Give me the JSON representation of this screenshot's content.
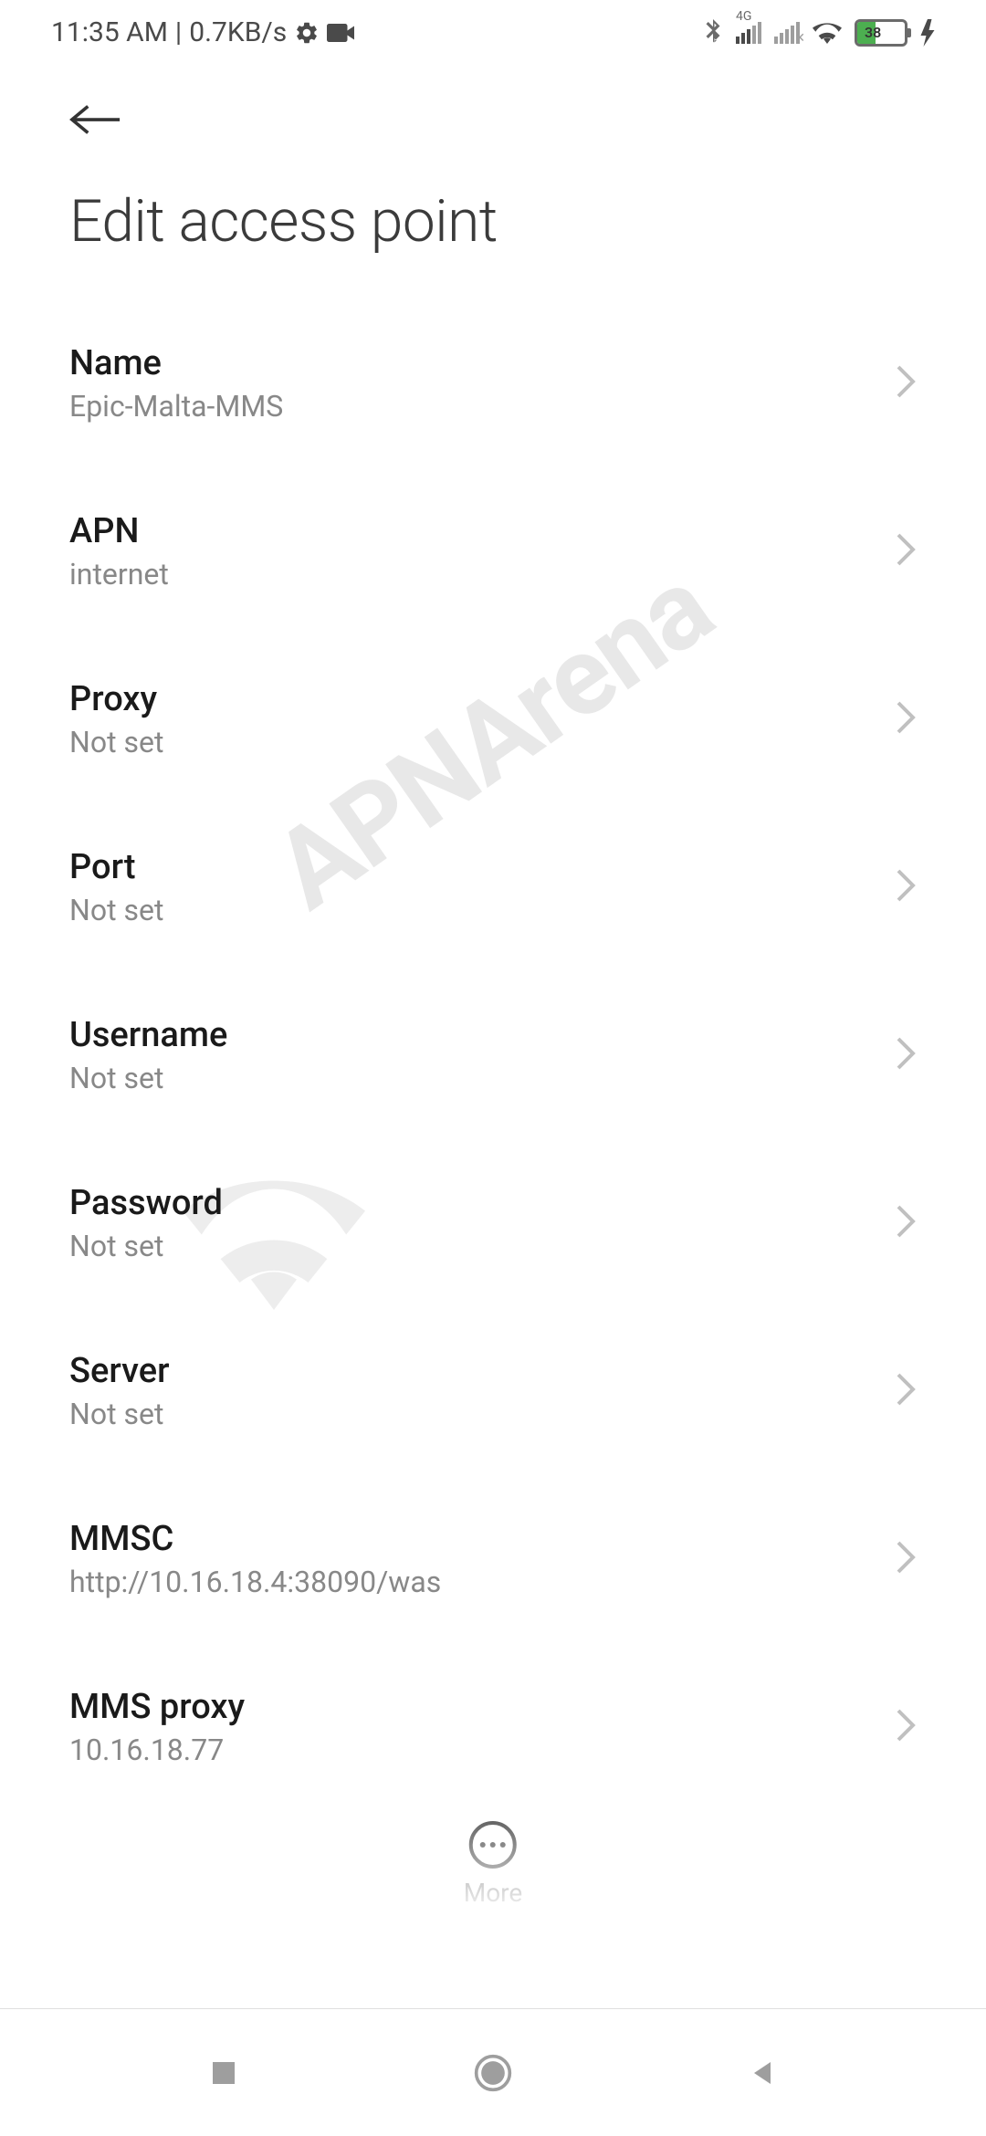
{
  "status": {
    "time": "11:35 AM",
    "speed": "0.7KB/s",
    "network_label": "4G",
    "battery_pct": "38"
  },
  "page_title": "Edit access point",
  "settings": [
    {
      "label": "Name",
      "value": "Epic-Malta-MMS"
    },
    {
      "label": "APN",
      "value": "internet"
    },
    {
      "label": "Proxy",
      "value": "Not set"
    },
    {
      "label": "Port",
      "value": "Not set"
    },
    {
      "label": "Username",
      "value": "Not set"
    },
    {
      "label": "Password",
      "value": "Not set"
    },
    {
      "label": "Server",
      "value": "Not set"
    },
    {
      "label": "MMSC",
      "value": "http://10.16.18.4:38090/was"
    },
    {
      "label": "MMS proxy",
      "value": "10.16.18.77"
    }
  ],
  "more_label": "More",
  "watermark": "APNArena"
}
